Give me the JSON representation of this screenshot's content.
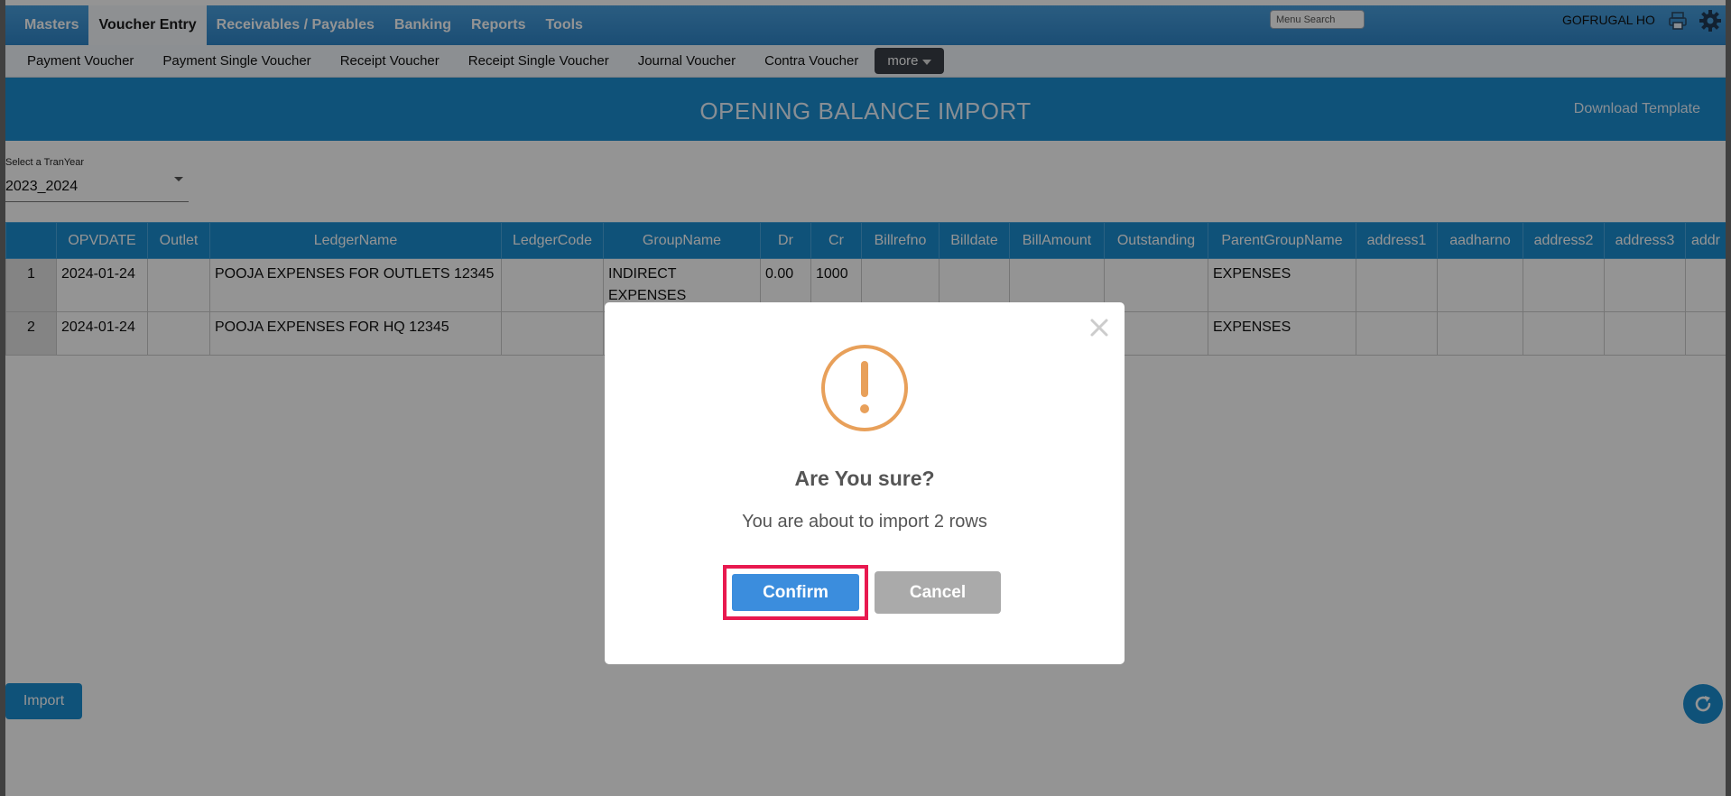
{
  "topnav": {
    "tabs": [
      {
        "label": "Masters"
      },
      {
        "label": "Voucher Entry"
      },
      {
        "label": "Receivables / Payables"
      },
      {
        "label": "Banking"
      },
      {
        "label": "Reports"
      },
      {
        "label": "Tools"
      }
    ],
    "active_tab": "Voucher Entry",
    "search_placeholder": "Menu Search",
    "user": "GOFRUGAL HO"
  },
  "subnav": {
    "items": [
      {
        "label": "Payment Voucher"
      },
      {
        "label": "Payment Single Voucher"
      },
      {
        "label": "Receipt Voucher"
      },
      {
        "label": "Receipt Single Voucher"
      },
      {
        "label": "Journal Voucher"
      },
      {
        "label": "Contra Voucher"
      }
    ],
    "more_label": "more"
  },
  "page": {
    "title": "OPENING BALANCE IMPORT",
    "download_label": "Download Template"
  },
  "tranyear": {
    "label": "Select a TranYear",
    "value": "2023_2024"
  },
  "table": {
    "columns": [
      "",
      "OPVDATE",
      "Outlet",
      "LedgerName",
      "LedgerCode",
      "GroupName",
      "Dr",
      "Cr",
      "Billrefno",
      "Billdate",
      "BillAmount",
      "Outstanding",
      "ParentGroupName",
      "address1",
      "aadharno",
      "address2",
      "address3",
      "addr"
    ],
    "rows": [
      [
        "1",
        "2024-01-24",
        "",
        "POOJA EXPENSES FOR OUTLETS 12345",
        "",
        "INDIRECT EXPENSES",
        "0.00",
        "1000",
        "",
        "",
        "",
        "",
        "EXPENSES",
        "",
        "",
        "",
        "",
        ""
      ],
      [
        "2",
        "2024-01-24",
        "",
        "POOJA EXPENSES FOR HQ 12345",
        "",
        "",
        "",
        "",
        "",
        "",
        "",
        "",
        "EXPENSES",
        "",
        "",
        "",
        "",
        ""
      ]
    ]
  },
  "actions": {
    "import_label": "Import"
  },
  "dialog": {
    "title": "Are You sure?",
    "message": "You are about to import 2 rows",
    "confirm_label": "Confirm",
    "cancel_label": "Cancel"
  },
  "colors": {
    "nav_blue": "#2f86c9",
    "header_blue": "#1b8ed1",
    "confirm_blue": "#3b8ddd",
    "warning_orange": "#e8a05a",
    "highlight_red": "#e8194f"
  },
  "icons": [
    "printer-icon",
    "gear-icon",
    "chevron-down-icon",
    "refresh-icon",
    "close-icon",
    "warning-icon"
  ]
}
